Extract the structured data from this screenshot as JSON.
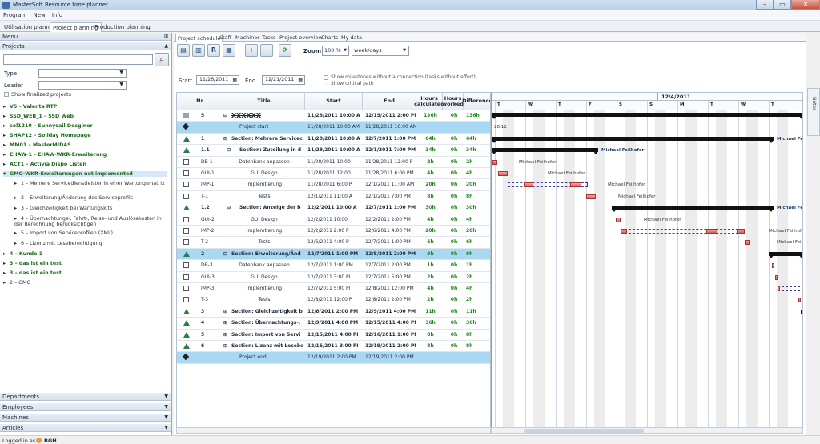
{
  "window": {
    "title": "MasterSoft Resource time planner"
  },
  "menu": [
    "Program",
    "New",
    "Info"
  ],
  "top_tabs": [
    "Utilisation planning",
    "Project planning",
    "Production planning"
  ],
  "left": {
    "menu_label": "Menu",
    "projects_label": "Projects",
    "type_label": "Type",
    "leader_label": "Leader",
    "show_finalized": "Show finalized projects",
    "tree": [
      {
        "label": "V5 – Valenta RTP",
        "level": 0,
        "bold": true
      },
      {
        "label": "SSD_WEB_1 – SSD Web",
        "level": 0,
        "bold": true
      },
      {
        "label": "sol1210 – Sunnysail Desginer",
        "level": 0,
        "bold": true
      },
      {
        "label": "SHAP12 – Soliday Homepage",
        "level": 0,
        "bold": true
      },
      {
        "label": "MM01 – MasterMIDAS",
        "level": 0,
        "bold": true
      },
      {
        "label": "EHAW-1 – EHAW-WKR-Erweiterung",
        "level": 0,
        "bold": true
      },
      {
        "label": "ACT1 – Activia Dispo Listen",
        "level": 0,
        "bold": true
      },
      {
        "label": "GMO-WKR-Erweiterungen not implemented",
        "level": 0,
        "bold": true,
        "selected": true
      },
      {
        "label": "1 – Mehrere Servicedienstleister in einer Wartungsmatrix",
        "level": 1
      },
      {
        "label": "2 – Erweiterung/Änderung des Serviceprofils",
        "level": 1
      },
      {
        "label": "3 – Gleichzeitigkeit bei Wartungskits",
        "level": 1
      },
      {
        "label": "4 – Übernachtungs-, Fahrt-, Reise- und Auslösekosten in der Berechnung berücksichtigen",
        "level": 1
      },
      {
        "label": "5 – Import von Serviceprofilen (XML)",
        "level": 1
      },
      {
        "label": "6 – Lizenz mit Leseberechtigung",
        "level": 1
      },
      {
        "label": "4 – Kunde 1",
        "level": 0,
        "bold": true
      },
      {
        "label": "3 – das ist ein test",
        "level": 0,
        "bold": true
      },
      {
        "label": "3 – das ist ein test",
        "level": 0,
        "bold": true
      },
      {
        "label": "2 – GMO",
        "level": 0,
        "bold": false
      }
    ],
    "bottom_sections": [
      "Departments",
      "Employees",
      "Machines",
      "Articles"
    ]
  },
  "status": {
    "logged_in_label": "Logged in as",
    "user": "BGH"
  },
  "main": {
    "sub_tabs": [
      "Project schedule",
      "Staff",
      "Machines",
      "Tasks",
      "Project overview",
      "Charts",
      "My data"
    ],
    "zoom_label": "Zoom",
    "zoom_value": "100 %",
    "view_value": "week/days",
    "start_label": "Start",
    "start_value": "11/26/2011",
    "end_label": "End",
    "end_value": "12/21/2011",
    "show_milestones": "Show milestones without a connection (tasks without effort)",
    "show_critical": "Show critical path",
    "notes_label": "Notes"
  },
  "grid": {
    "headers": [
      "Nr",
      "Title",
      "Start",
      "End",
      "Hours calculated",
      "Hours worked",
      "Difference"
    ],
    "rows": [
      {
        "nr": "5",
        "title": "XXXXXX",
        "start": "11/28/2011 10:00 A",
        "end": "12/19/2011 2:00 PM",
        "calc": "136h",
        "worked": "0h",
        "diff": "136h",
        "bold": true,
        "hl": false,
        "indent": 0,
        "exp": "⊟"
      },
      {
        "nr": "",
        "title": "Project start",
        "start": "11/28/2011 10:00 AM",
        "end": "11/28/2011 10:00 AM",
        "calc": "",
        "worked": "",
        "diff": "",
        "bold": false,
        "hl": true,
        "indent": 1,
        "exp": ""
      },
      {
        "nr": "1",
        "title": "Section: Mehrere Servicec",
        "start": "11/28/2011 10:00 A",
        "end": "12/7/2011 1:00 PM",
        "calc": "64h",
        "worked": "0h",
        "diff": "64h",
        "bold": true,
        "hl": false,
        "indent": 0,
        "exp": "⊟"
      },
      {
        "nr": "1.1",
        "title": "Section: Zuteilung in d",
        "start": "11/28/2011 10:00 A",
        "end": "12/1/2011 7:00 PM",
        "calc": "34h",
        "worked": "0h",
        "diff": "34h",
        "bold": true,
        "hl": false,
        "indent": 1,
        "exp": "⊟"
      },
      {
        "nr": "DB-1",
        "title": "Datenbank anpassen",
        "start": "11/28/2011 10:00",
        "end": "11/28/2011 12:00 P",
        "calc": "2h",
        "worked": "0h",
        "diff": "2h",
        "bold": false,
        "hl": false,
        "indent": 2,
        "exp": ""
      },
      {
        "nr": "GUI-1",
        "title": "GUI Design",
        "start": "11/28/2011 12:00",
        "end": "11/28/2011 6:00 PM",
        "calc": "4h",
        "worked": "0h",
        "diff": "4h",
        "bold": false,
        "hl": false,
        "indent": 2,
        "exp": ""
      },
      {
        "nr": "IMP-1",
        "title": "Implemtierung",
        "start": "11/28/2011 6:00 P",
        "end": "12/1/2011 11:00 AM",
        "calc": "20h",
        "worked": "0h",
        "diff": "20h",
        "bold": false,
        "hl": false,
        "indent": 2,
        "exp": ""
      },
      {
        "nr": "T-1",
        "title": "Tests",
        "start": "12/1/2011 11:00 A",
        "end": "12/1/2011 7:00 PM",
        "calc": "8h",
        "worked": "0h",
        "diff": "8h",
        "bold": false,
        "hl": false,
        "indent": 2,
        "exp": ""
      },
      {
        "nr": "1.2",
        "title": "Section: Anzeige der b",
        "start": "12/2/2011 10:00 A",
        "end": "12/7/2011 1:00 PM",
        "calc": "30h",
        "worked": "0h",
        "diff": "30h",
        "bold": true,
        "hl": false,
        "indent": 1,
        "exp": "⊟"
      },
      {
        "nr": "GUI-2",
        "title": "GUI Design",
        "start": "12/2/2011 10:00",
        "end": "12/2/2011 2:00 PM",
        "calc": "4h",
        "worked": "0h",
        "diff": "4h",
        "bold": false,
        "hl": false,
        "indent": 2,
        "exp": ""
      },
      {
        "nr": "IMP-2",
        "title": "Implemtierung",
        "start": "12/2/2011 2:00 P",
        "end": "12/6/2011 4:00 PM",
        "calc": "20h",
        "worked": "0h",
        "diff": "20h",
        "bold": false,
        "hl": false,
        "indent": 2,
        "exp": ""
      },
      {
        "nr": "T-2",
        "title": "Tests",
        "start": "12/6/2011 4:00 P",
        "end": "12/7/2011 1:00 PM",
        "calc": "6h",
        "worked": "0h",
        "diff": "6h",
        "bold": false,
        "hl": false,
        "indent": 2,
        "exp": ""
      },
      {
        "nr": "2",
        "title": "Section: Erweiterung/Änd",
        "start": "12/7/2011 1:00 PM",
        "end": "12/8/2011 2:00 PM",
        "calc": "9h",
        "worked": "0h",
        "diff": "9h",
        "bold": true,
        "hl": true,
        "indent": 0,
        "exp": "⊟"
      },
      {
        "nr": "DB-3",
        "title": "Datenbank anpassen",
        "start": "12/7/2011 1:00 PM",
        "end": "12/7/2011 2:00 PM",
        "calc": "1h",
        "worked": "0h",
        "diff": "1h",
        "bold": false,
        "hl": false,
        "indent": 2,
        "exp": ""
      },
      {
        "nr": "GUI-3",
        "title": "GUI Design",
        "start": "12/7/2011 3:00 PI",
        "end": "12/7/2011 5:00 PM",
        "calc": "2h",
        "worked": "0h",
        "diff": "2h",
        "bold": false,
        "hl": false,
        "indent": 2,
        "exp": ""
      },
      {
        "nr": "IMP-3",
        "title": "Implemtierung",
        "start": "12/7/2011 5:00 PI",
        "end": "12/8/2011 12:00 PM",
        "calc": "4h",
        "worked": "0h",
        "diff": "4h",
        "bold": false,
        "hl": false,
        "indent": 2,
        "exp": ""
      },
      {
        "nr": "T-3",
        "title": "Tests",
        "start": "12/8/2011 12:00 P",
        "end": "12/8/2011 2:00 PM",
        "calc": "2h",
        "worked": "0h",
        "diff": "2h",
        "bold": false,
        "hl": false,
        "indent": 2,
        "exp": ""
      },
      {
        "nr": "3",
        "title": "Section: Gleichzeitigkeit b",
        "start": "12/8/2011 2:00 PM",
        "end": "12/9/2011 4:00 PM",
        "calc": "11h",
        "worked": "0h",
        "diff": "11h",
        "bold": true,
        "hl": false,
        "indent": 0,
        "exp": "⊞"
      },
      {
        "nr": "4",
        "title": "Section: Übernachtungs-,",
        "start": "12/9/2011 4:00 PM",
        "end": "12/15/2011 4:00 PM",
        "calc": "36h",
        "worked": "0h",
        "diff": "36h",
        "bold": true,
        "hl": false,
        "indent": 0,
        "exp": "⊞"
      },
      {
        "nr": "5",
        "title": "Section: Import von Servi",
        "start": "12/15/2011 4:00 PI",
        "end": "12/16/2011 1:00 PM",
        "calc": "8h",
        "worked": "0h",
        "diff": "8h",
        "bold": true,
        "hl": false,
        "indent": 0,
        "exp": "⊞"
      },
      {
        "nr": "6",
        "title": "Section: Lizenz mit Lesebe",
        "start": "12/16/2011 3:00 PI",
        "end": "12/19/2011 2:00 PM",
        "calc": "8h",
        "worked": "0h",
        "diff": "8h",
        "bold": true,
        "hl": false,
        "indent": 0,
        "exp": "⊞"
      },
      {
        "nr": "",
        "title": "Project end",
        "start": "12/19/2011 2:00 PM",
        "end": "12/19/2011 2:00 PM",
        "calc": "",
        "worked": "",
        "diff": "",
        "bold": false,
        "hl": true,
        "indent": 1,
        "exp": ""
      }
    ]
  },
  "gantt": {
    "week_label": "12/4/2011",
    "days": [
      "T",
      "W",
      "T",
      "F",
      "S",
      "S",
      "M",
      "T",
      "W",
      "T"
    ],
    "milestone_label": "28.11",
    "resource": "Michael Feilhofer"
  }
}
